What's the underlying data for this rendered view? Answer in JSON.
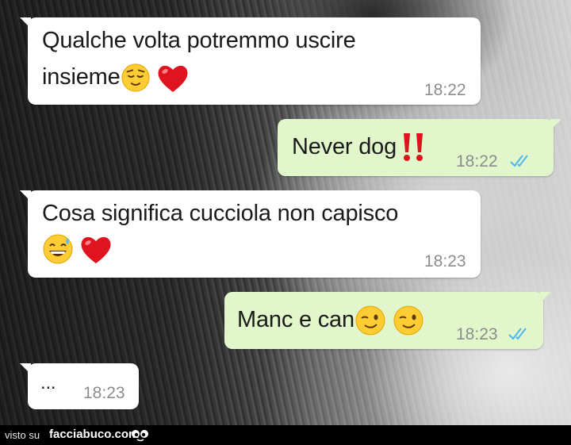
{
  "messages": [
    {
      "direction": "incoming",
      "lines": [
        "Qualche volta potremmo uscire",
        "insieme"
      ],
      "emojis": [
        "relieved-face",
        "red-heart"
      ],
      "time": "18:22"
    },
    {
      "direction": "outgoing",
      "text": "Never dog",
      "emojis": [
        "double-exclamation-mark"
      ],
      "time": "18:22",
      "status": "read"
    },
    {
      "direction": "incoming",
      "lines": [
        "Cosa significa cucciola non capisco"
      ],
      "emojis": [
        "grinning-face-with-sweat",
        "red-heart"
      ],
      "time": "18:23"
    },
    {
      "direction": "outgoing",
      "text": "Manc e can",
      "emojis": [
        "winking-face",
        "winking-face"
      ],
      "time": "18:23",
      "status": "read"
    },
    {
      "direction": "incoming",
      "text": "...",
      "time": "18:23"
    }
  ],
  "footer": {
    "prefix": "visto su",
    "site": "facciabuco.com"
  },
  "colors": {
    "incoming": "#ffffff",
    "outgoing": "#e1f7cb",
    "read_ticks": "#4fb6ec",
    "time": "#8c8c8c"
  }
}
